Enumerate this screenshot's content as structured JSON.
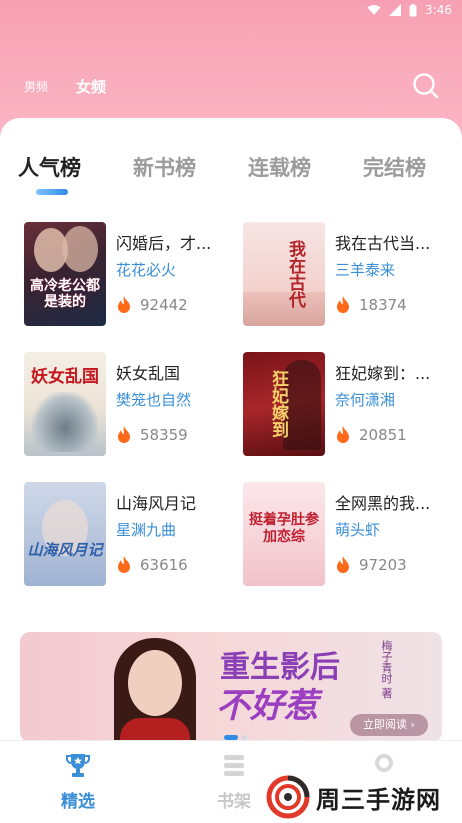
{
  "status_bar": {
    "time": "3:46"
  },
  "gender_tabs": {
    "male": "男频",
    "female": "女频"
  },
  "rank_tabs": [
    "人气榜",
    "新书榜",
    "连载榜",
    "完结榜"
  ],
  "books": [
    {
      "title": "闪婚后，才...",
      "author": "花花必火",
      "hot": "92442",
      "cover_text": "高冷老公都是装的"
    },
    {
      "title": "我在古代当...",
      "author": "三羊泰来",
      "hot": "18374",
      "cover_text": "我在古代"
    },
    {
      "title": "妖女乱国",
      "author": "樊笼也自然",
      "hot": "58359",
      "cover_text": "妖女乱国"
    },
    {
      "title": "狂妃嫁到：...",
      "author": "奈何潇湘",
      "hot": "20851",
      "cover_text": "狂妃嫁到"
    },
    {
      "title": "山海风月记",
      "author": "星渊九曲",
      "hot": "63616",
      "cover_text": "山海风月记"
    },
    {
      "title": "全网黑的我...",
      "author": "萌头虾",
      "hot": "97203",
      "cover_text": "挺着孕肚参加恋综"
    }
  ],
  "banner": {
    "title_line1": "重生影后",
    "title_line2": "不好惹",
    "author": "梅子青时 著",
    "cta": "立即阅读 ›"
  },
  "bottom_nav": {
    "picks": "精选",
    "shelf": "书架"
  },
  "watermark": {
    "text": "周三手游网"
  },
  "colors": {
    "accent_blue": "#3a8fd6",
    "header_pink": "#f7a0b3",
    "fire": "#ff6a1a"
  }
}
